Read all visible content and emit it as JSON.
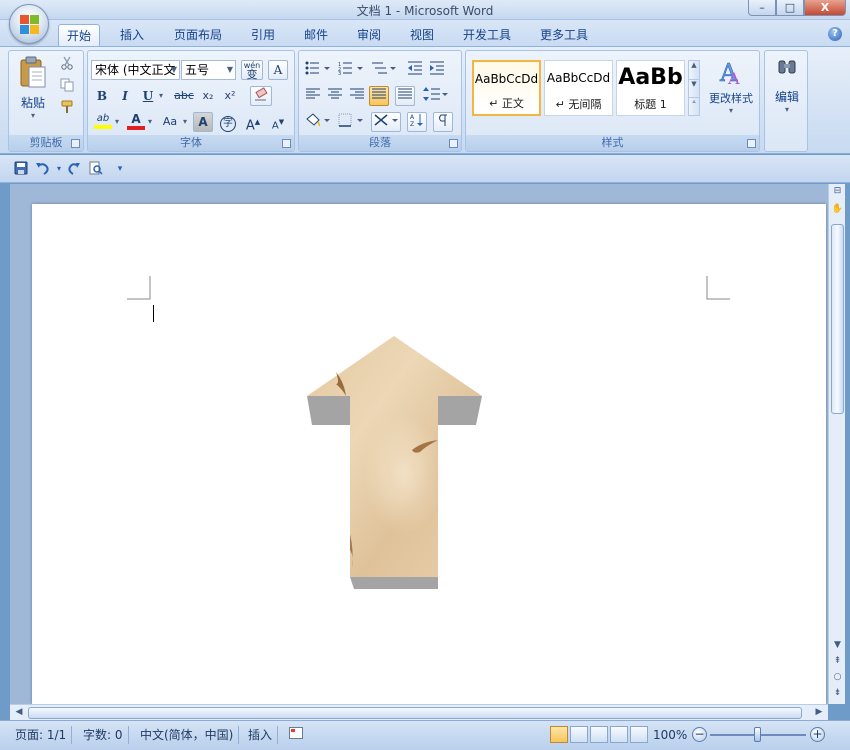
{
  "window": {
    "title": "文档 1 - Microsoft Word",
    "minimize": "–",
    "maximize": "□",
    "close": "X"
  },
  "tabs": [
    "开始",
    "插入",
    "页面布局",
    "引用",
    "邮件",
    "审阅",
    "视图",
    "开发工具",
    "更多工具"
  ],
  "active_tab": "开始",
  "help": "?",
  "ribbon": {
    "clipboard": {
      "label": "剪贴板",
      "paste": "粘贴"
    },
    "font": {
      "label": "字体",
      "font_name": "宋体 (中文正文",
      "font_size": "五号",
      "wen": "wén",
      "bold": "B",
      "italic": "I",
      "underline": "U",
      "strike": "abc",
      "sub": "x₂",
      "sup": "x²",
      "highlight": "ab",
      "color": "A",
      "case": "Aa",
      "char_shade": "A",
      "enclose": "字",
      "grow": "A",
      "shrink": "A"
    },
    "paragraph": {
      "label": "段落"
    },
    "styles": {
      "label": "样式",
      "items": [
        {
          "sample": "AaBbCcDd",
          "name": "↵ 正文"
        },
        {
          "sample": "AaBbCcDd",
          "name": "↵ 无间隔"
        },
        {
          "sample": "AaBb",
          "name": "标题 1"
        }
      ],
      "change_styles": "更改样式"
    },
    "editing": {
      "label": "编辑"
    }
  },
  "status": {
    "page": "页面: 1/1",
    "words": "字数: 0",
    "language": "中文(简体，中国)",
    "mode": "插入",
    "zoom": "100%",
    "zoom_minus": "−",
    "zoom_plus": "+"
  },
  "colors": {
    "accent": "#15428b",
    "highlight_yellow": "#ffff00",
    "font_red": "#e02020",
    "arrow_side": "#a4a4a4"
  }
}
